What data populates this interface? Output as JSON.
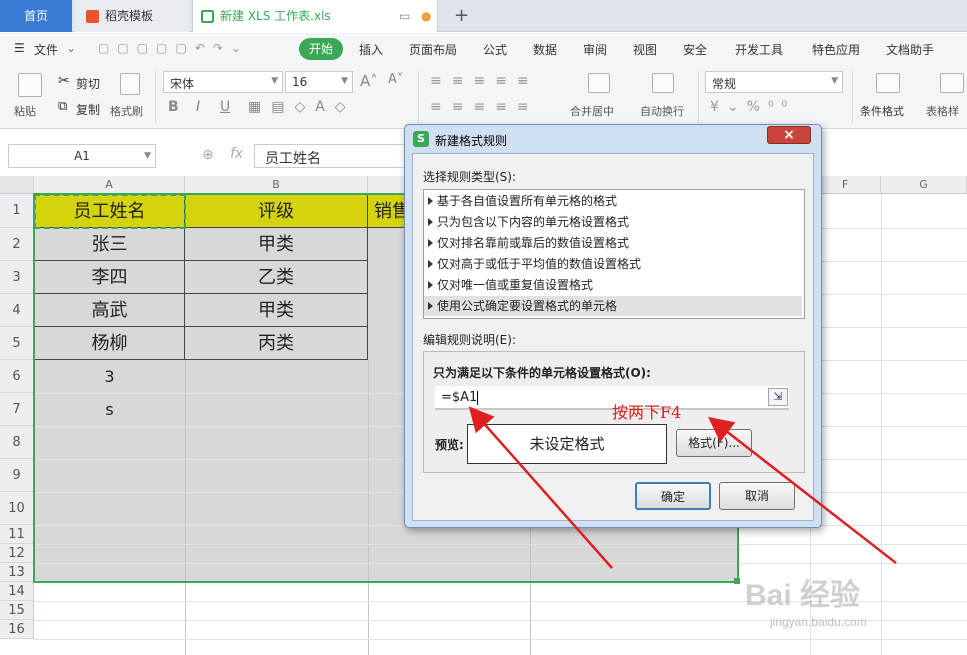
{
  "tabs": {
    "home": "首页",
    "template": "稻壳模板",
    "file": "新建 XLS 工作表.xls",
    "new_tab": "+"
  },
  "menu": {
    "file": "文件",
    "start": "开始",
    "insert": "插入",
    "layout": "页面布局",
    "formula": "公式",
    "data": "数据",
    "review": "审阅",
    "view": "视图",
    "security": "安全",
    "dev": "开发工具",
    "special": "特色应用",
    "doc_helper": "文档助手"
  },
  "ribbon": {
    "paste": "粘贴",
    "cut": "剪切",
    "copy": "复制",
    "format_painter": "格式刷",
    "font_name": "宋体",
    "font_size": "16",
    "bold": "B",
    "italic": "I",
    "underline": "U",
    "merge": "合并居中",
    "wrap": "自动换行",
    "number_format": "常规",
    "cond_format": "条件格式",
    "table_style": "表格样"
  },
  "formula_bar": {
    "cell_ref": "A1",
    "fx": "fx",
    "content": "员工姓名"
  },
  "columns": [
    "A",
    "B",
    "",
    "",
    "",
    "F",
    "G"
  ],
  "rows": [
    "1",
    "2",
    "3",
    "4",
    "5",
    "6",
    "7",
    "8",
    "9",
    "10",
    "11",
    "12",
    "13",
    "14",
    "15",
    "16"
  ],
  "cells": {
    "A1": "员工姓名",
    "B1": "评级",
    "C1": "销售",
    "A2": "张三",
    "B2": "甲类",
    "A3": "李四",
    "B3": "乙类",
    "A4": "高武",
    "B4": "甲类",
    "A5": "杨柳",
    "B5": "丙类",
    "A6": "3",
    "A7": "s"
  },
  "colors": {
    "header_fill": "#d5d40c",
    "selection_fill": "#d8d8d8",
    "selection_border": "#3aa857",
    "accent": "#3aa857"
  },
  "dialog": {
    "title": "新建格式规则",
    "close": "×",
    "rule_type_label": "选择规则类型(S):",
    "rule_types": [
      "基于各自值设置所有单元格的格式",
      "只为包含以下内容的单元格设置格式",
      "仅对排名靠前或靠后的数值设置格式",
      "仅对高于或低于平均值的数值设置格式",
      "仅对唯一值或重复值设置格式",
      "使用公式确定要设置格式的单元格"
    ],
    "selected_rule": 5,
    "edit_label": "编辑规则说明(E):",
    "condition_label": "只为满足以下条件的单元格设置格式(O):",
    "formula": "=$A1",
    "preview_label": "预览:",
    "preview_text": "未设定格式",
    "format_button": "格式(F)...",
    "ok": "确定",
    "cancel": "取消"
  },
  "annotation": "按两下F4",
  "watermark": {
    "brand": "Bai 经验",
    "url": "jingyan.baidu.com"
  }
}
